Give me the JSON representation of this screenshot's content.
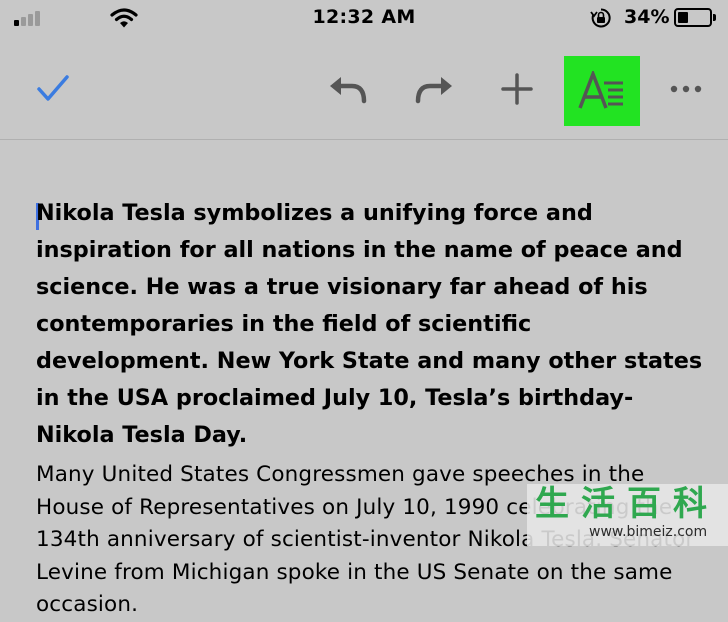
{
  "status_bar": {
    "time": "12:32 AM",
    "battery_percent": "34%",
    "battery_level": 0.34,
    "signal_bars_filled": 1,
    "icons": [
      "signal-icon",
      "wifi-icon",
      "orientation-lock-icon",
      "battery-icon"
    ]
  },
  "toolbar": {
    "icons": [
      "checkmark-icon",
      "undo-icon",
      "redo-icon",
      "plus-icon",
      "text-format-icon",
      "more-icon"
    ],
    "accent_color": "#3b7ce0",
    "highlight_color": "#22e322"
  },
  "document": {
    "bold_paragraph": "Nikola Tesla symbolizes a unifying force and inspiration for all nations in the name of peace and science. He was a true visionary far ahead of his contemporaries in the field of scientific development. New York State and many other states in the USA proclaimed July 10, Tesla’s birthday- Nikola Tesla Day.",
    "normal_paragraph": "Many United States Congressmen gave speeches in the House of Representatives on July 10, 1990 celebrating the 134th anniversary of scientist-inventor Nikola Tesla. Senator Levine from Michigan spoke in the US Senate on the same occasion."
  },
  "watermark": {
    "chinese": "生活百科",
    "url": "www.bimeiz.com"
  }
}
